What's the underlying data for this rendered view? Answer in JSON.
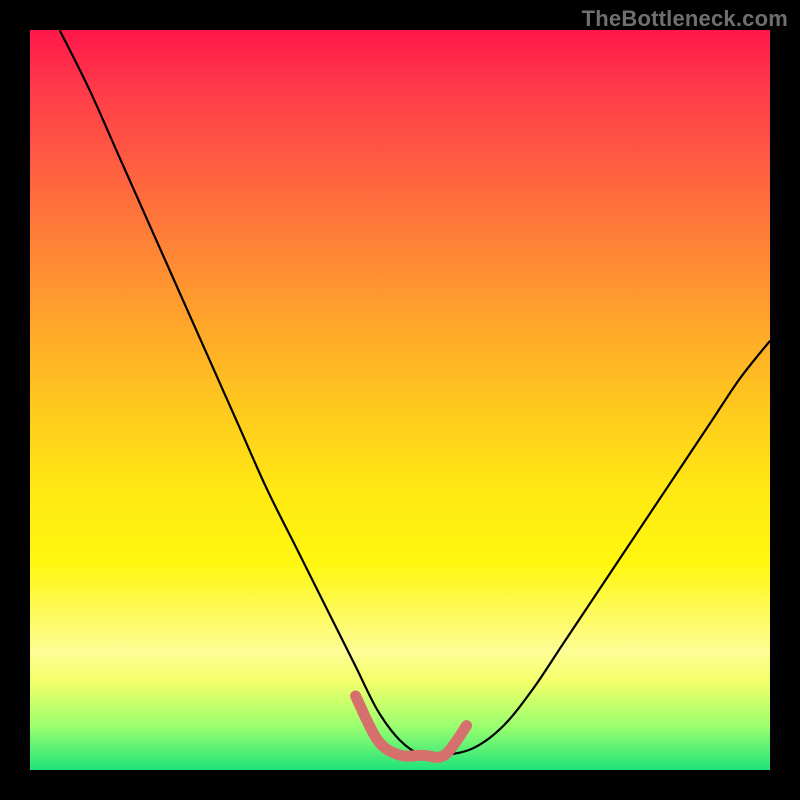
{
  "watermark": {
    "text": "TheBottleneck.com"
  },
  "colors": {
    "background": "#000000",
    "curve_main": "#000000",
    "curve_highlight": "#d6706d"
  },
  "chart_data": {
    "type": "line",
    "title": "",
    "xlabel": "",
    "ylabel": "",
    "xlim": [
      0,
      100
    ],
    "ylim": [
      0,
      100
    ],
    "series": [
      {
        "name": "main-curve",
        "x": [
          4,
          8,
          12,
          16,
          20,
          24,
          28,
          32,
          36,
          40,
          44,
          47,
          50,
          53,
          56,
          60,
          64,
          68,
          72,
          76,
          80,
          84,
          88,
          92,
          96,
          100
        ],
        "y": [
          100,
          92,
          83,
          74,
          65,
          56,
          47,
          38,
          30,
          22,
          14,
          8,
          4,
          2,
          2,
          3,
          6,
          11,
          17,
          23,
          29,
          35,
          41,
          47,
          53,
          58
        ]
      },
      {
        "name": "highlight-segment",
        "x": [
          44,
          47,
          50,
          53,
          56,
          59
        ],
        "y": [
          10,
          4,
          2,
          2,
          2,
          6
        ]
      }
    ]
  }
}
